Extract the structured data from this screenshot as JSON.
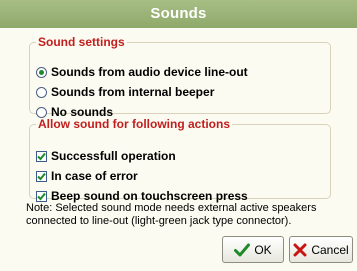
{
  "dialog": {
    "title": "Sounds"
  },
  "sound_settings": {
    "legend": "Sound settings",
    "options": [
      {
        "label": "Sounds from audio device line-out",
        "selected": true
      },
      {
        "label": "Sounds from internal beeper",
        "selected": false
      },
      {
        "label": "No sounds",
        "selected": false
      }
    ]
  },
  "actions": {
    "legend": "Allow sound for following actions",
    "items": [
      {
        "label": "Successfull operation",
        "checked": true
      },
      {
        "label": "In case of error",
        "checked": true
      },
      {
        "label": "Beep sound on touchscreen press",
        "checked": true
      }
    ]
  },
  "note": "Note: Selected sound mode needs external active speakers connected to line-out (light-green jack type connector).",
  "buttons": {
    "ok": "OK",
    "cancel": "Cancel"
  },
  "icons": {
    "ok": "checkmark-icon",
    "cancel": "x-cross-icon"
  },
  "colors": {
    "title_bg": "#9ab276",
    "legend": "#c21e1e",
    "ok_check": "#1e8a2a",
    "cancel_x": "#c91414"
  }
}
